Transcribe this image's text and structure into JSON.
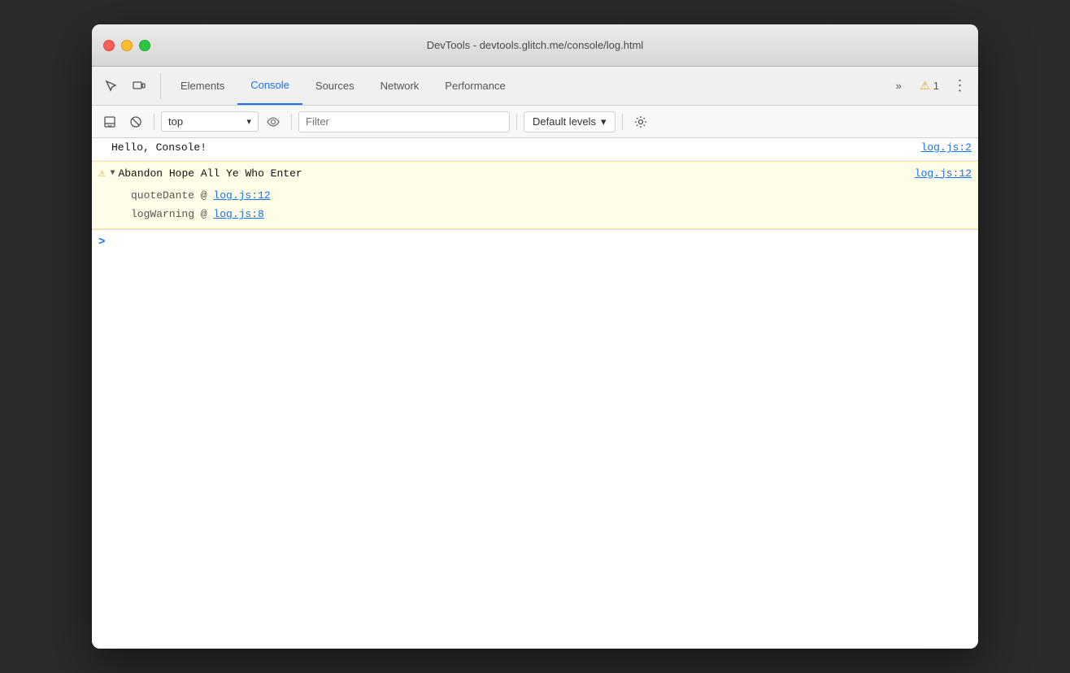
{
  "window": {
    "title": "DevTools - devtools.glitch.me/console/log.html"
  },
  "tabs": {
    "items": [
      {
        "id": "elements",
        "label": "Elements",
        "active": false
      },
      {
        "id": "console",
        "label": "Console",
        "active": true
      },
      {
        "id": "sources",
        "label": "Sources",
        "active": false
      },
      {
        "id": "network",
        "label": "Network",
        "active": false
      },
      {
        "id": "performance",
        "label": "Performance",
        "active": false
      }
    ],
    "overflow_label": "»",
    "warning_count": "1",
    "more_label": "⋮"
  },
  "console_toolbar": {
    "context_value": "top",
    "context_arrow": "▾",
    "filter_placeholder": "Filter",
    "levels_label": "Default levels",
    "levels_arrow": "▾"
  },
  "console_output": {
    "rows": [
      {
        "type": "info",
        "message": "Hello, Console!",
        "source": "log.js:2"
      }
    ],
    "warning_group": {
      "icon": "⚠",
      "arrow": "▼",
      "message": "Abandon Hope All Ye Who Enter",
      "source": "log.js:12",
      "stack": [
        {
          "prefix": "quoteDante @ ",
          "link": "log.js:12"
        },
        {
          "prefix": "logWarning @ ",
          "link": "log.js:8"
        }
      ]
    },
    "prompt": ">"
  }
}
